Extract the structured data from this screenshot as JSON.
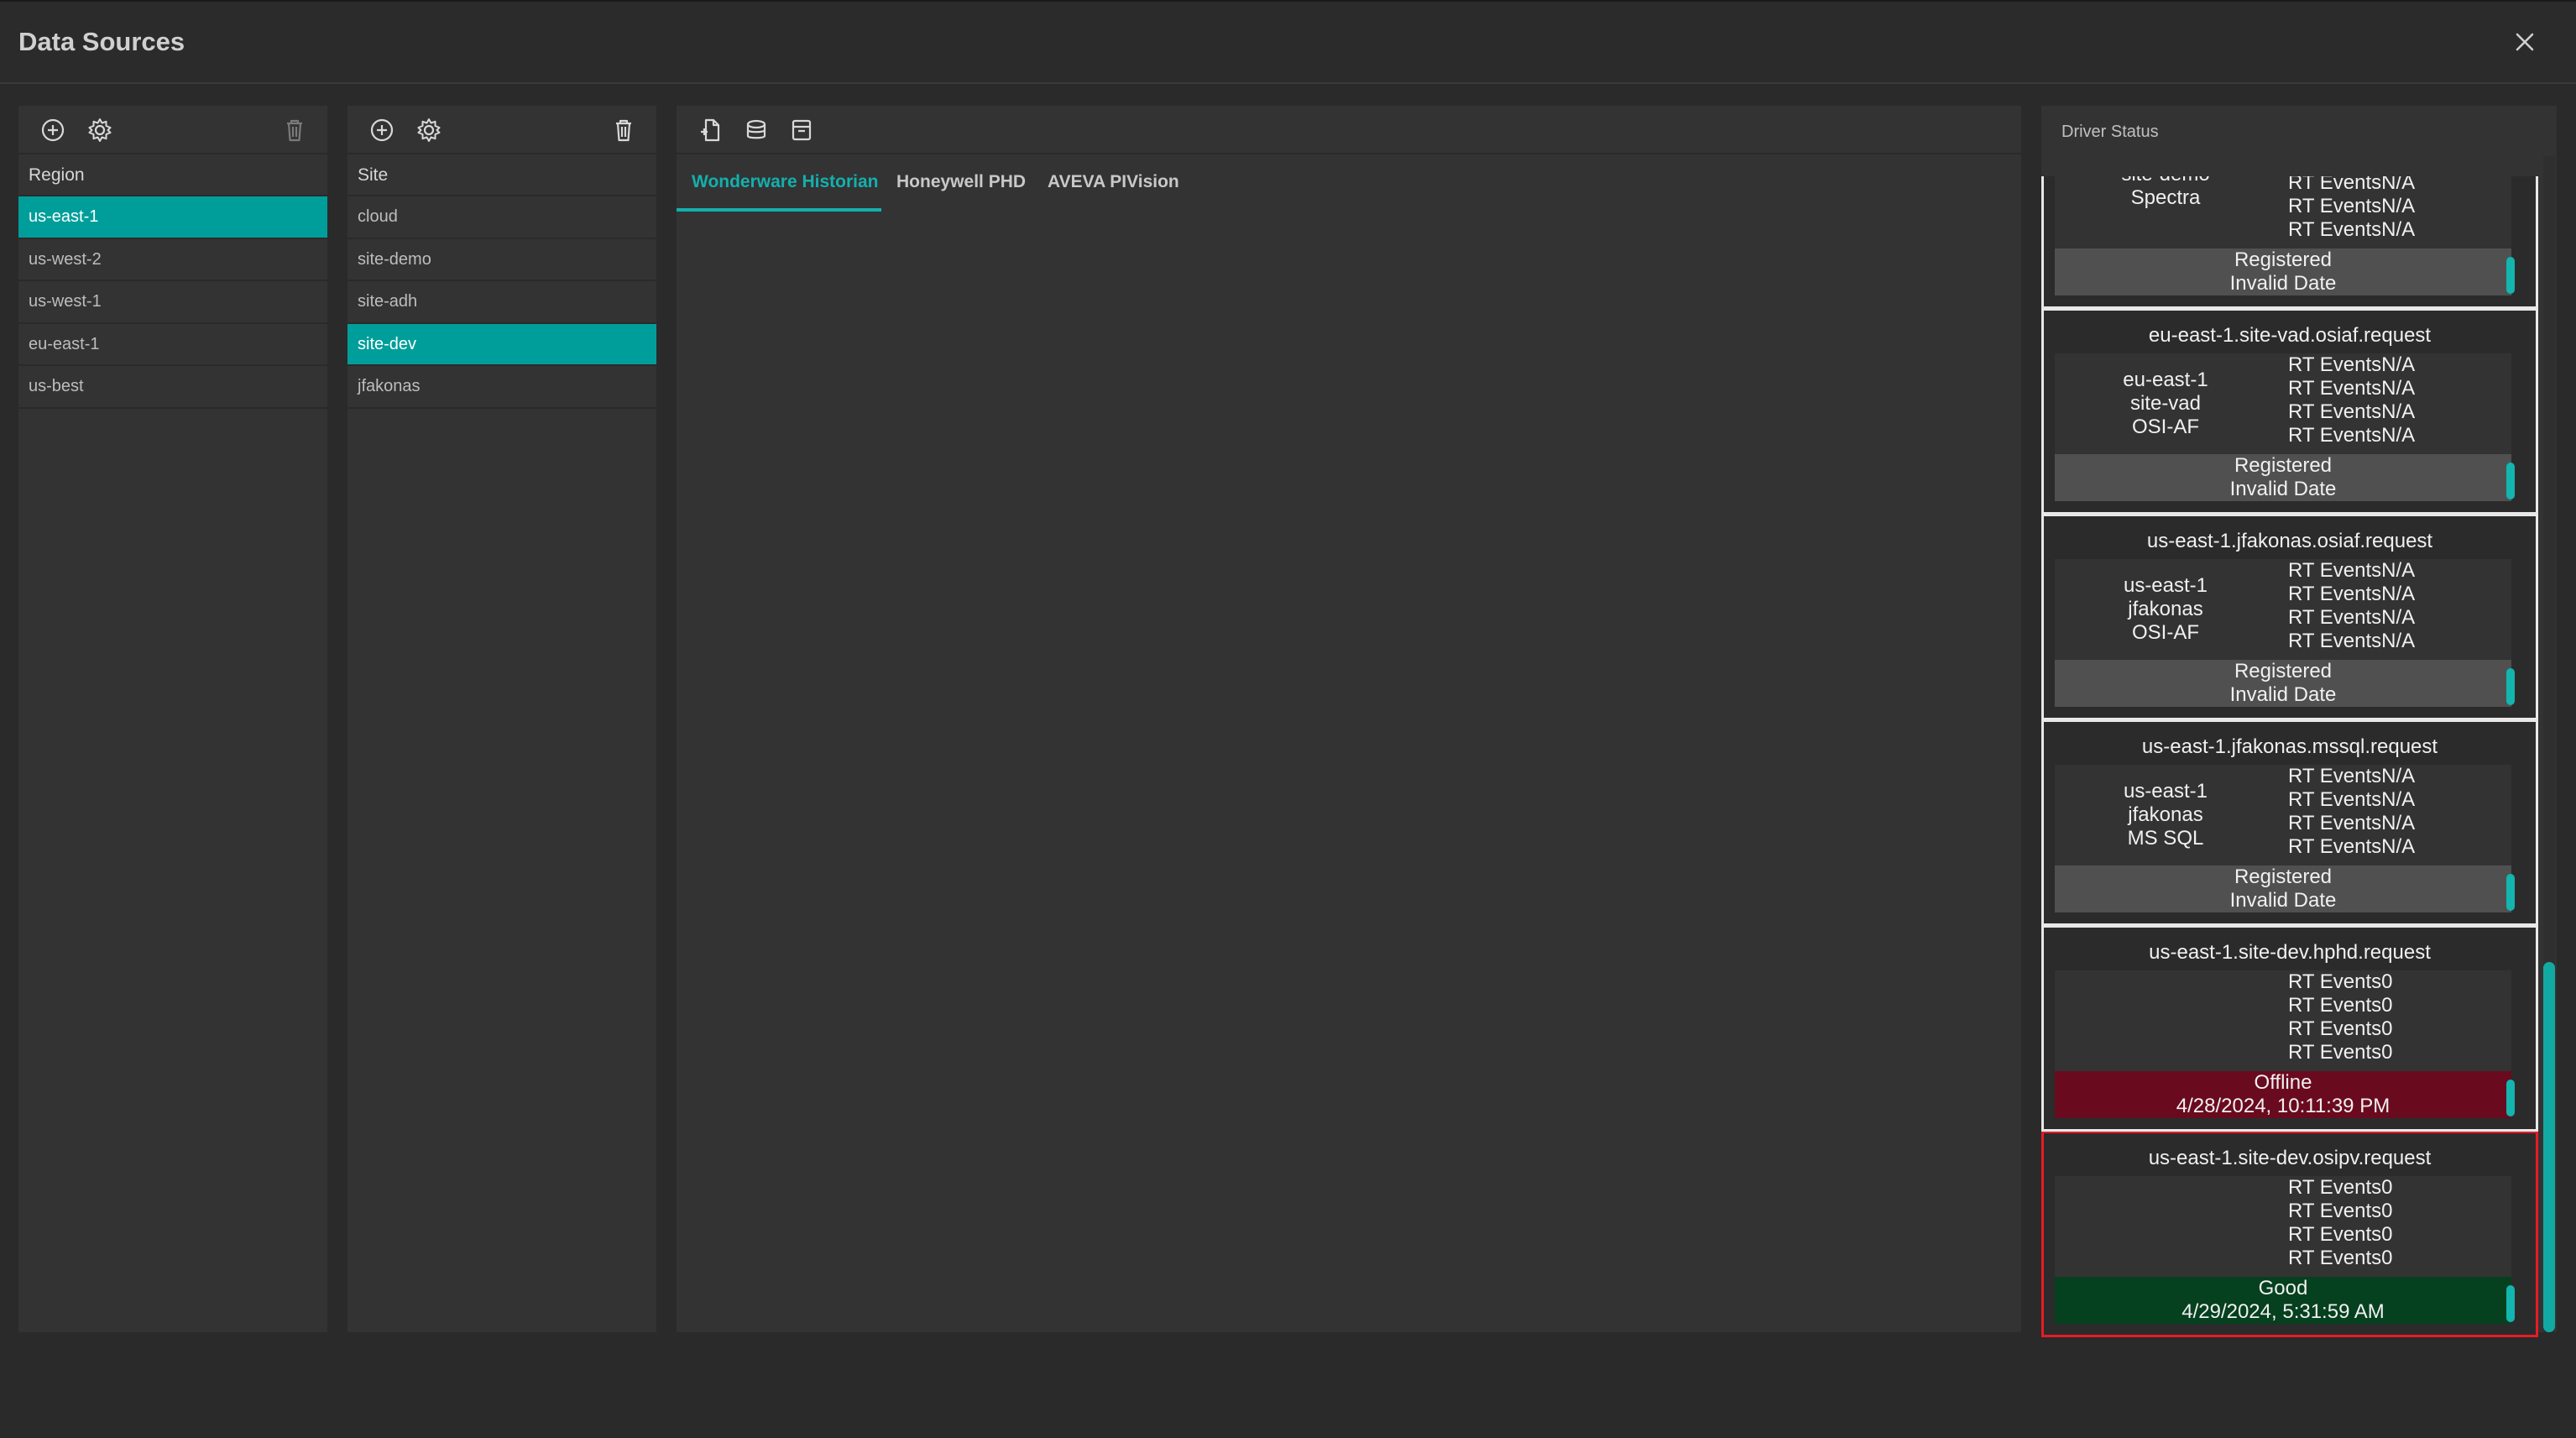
{
  "window": {
    "title": "Data Sources"
  },
  "region_panel": {
    "header": "Region",
    "items": [
      {
        "label": "us-east-1",
        "selected": true
      },
      {
        "label": "us-west-2",
        "selected": false
      },
      {
        "label": "us-west-1",
        "selected": false
      },
      {
        "label": "eu-east-1",
        "selected": false
      },
      {
        "label": "us-best",
        "selected": false
      }
    ]
  },
  "site_panel": {
    "header": "Site",
    "items": [
      {
        "label": "cloud",
        "selected": false
      },
      {
        "label": "site-demo",
        "selected": false
      },
      {
        "label": "site-adh",
        "selected": false
      },
      {
        "label": "site-dev",
        "selected": true
      },
      {
        "label": "jfakonas",
        "selected": false
      }
    ]
  },
  "main_panel": {
    "tabs": [
      {
        "label": "Wonderware Historian",
        "active": true
      },
      {
        "label": "Honeywell PHD",
        "active": false
      },
      {
        "label": "AVEVA PIVision",
        "active": false
      }
    ]
  },
  "driver_status": {
    "label": "Driver Status",
    "cards": [
      {
        "name": "",
        "info": [
          "",
          "site-demo",
          "Spectra"
        ],
        "events": [
          "RT EventsN/A",
          "RT EventsN/A",
          "RT EventsN/A",
          "RT EventsN/A"
        ],
        "status": "Registered",
        "date": "Invalid Date",
        "state": "registered",
        "highlight": false
      },
      {
        "name": "eu-east-1.site-vad.osiaf.request",
        "info": [
          "eu-east-1",
          "site-vad",
          "OSI-AF"
        ],
        "events": [
          "RT EventsN/A",
          "RT EventsN/A",
          "RT EventsN/A",
          "RT EventsN/A"
        ],
        "status": "Registered",
        "date": "Invalid Date",
        "state": "registered",
        "highlight": false
      },
      {
        "name": "us-east-1.jfakonas.osiaf.request",
        "info": [
          "us-east-1",
          "jfakonas",
          "OSI-AF"
        ],
        "events": [
          "RT EventsN/A",
          "RT EventsN/A",
          "RT EventsN/A",
          "RT EventsN/A"
        ],
        "status": "Registered",
        "date": "Invalid Date",
        "state": "registered",
        "highlight": false
      },
      {
        "name": "us-east-1.jfakonas.mssql.request",
        "info": [
          "us-east-1",
          "jfakonas",
          "MS SQL"
        ],
        "events": [
          "RT EventsN/A",
          "RT EventsN/A",
          "RT EventsN/A",
          "RT EventsN/A"
        ],
        "status": "Registered",
        "date": "Invalid Date",
        "state": "registered",
        "highlight": false
      },
      {
        "name": "us-east-1.site-dev.hphd.request",
        "info": [
          "",
          "",
          ""
        ],
        "events": [
          "RT Events0",
          "RT Events0",
          "RT Events0",
          "RT Events0"
        ],
        "status": "Offline",
        "date": "4/28/2024, 10:11:39 PM",
        "state": "offline",
        "highlight": false
      },
      {
        "name": "us-east-1.site-dev.osipv.request",
        "info": [
          "",
          "",
          ""
        ],
        "events": [
          "RT Events0",
          "RT Events0",
          "RT Events0",
          "RT Events0"
        ],
        "status": "Good",
        "date": "4/29/2024, 5:31:59 AM",
        "state": "good",
        "highlight": true
      }
    ]
  },
  "colors": {
    "accent": "#009e9a",
    "offline": "#6a0a1e",
    "good": "#05401f",
    "highlight": "#e51d24"
  }
}
